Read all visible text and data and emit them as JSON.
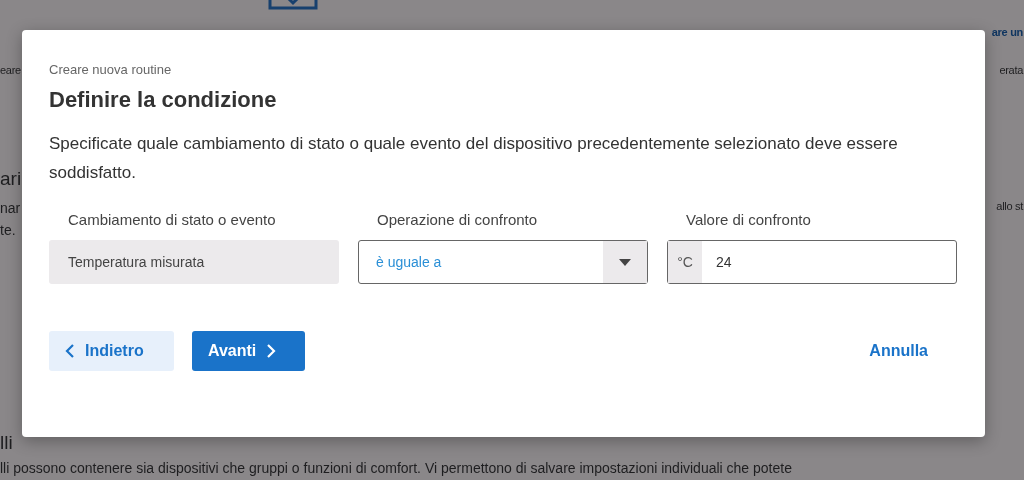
{
  "background": {
    "texts": [
      {
        "kind": "link",
        "text": "are un"
      },
      {
        "kind": "plain",
        "text": "eare"
      },
      {
        "kind": "plain",
        "text": "erata"
      },
      {
        "kind": "heading",
        "text": "ari"
      },
      {
        "kind": "plain",
        "text": "nar"
      },
      {
        "kind": "plain",
        "text": "te."
      },
      {
        "kind": "plain",
        "text": "allo st"
      },
      {
        "kind": "heading",
        "text": "lli"
      },
      {
        "kind": "plain",
        "text": "lli possono contenere sia dispositivi che gruppi o funzioni di comfort. Vi permettono di salvare impostazioni individuali che potete"
      }
    ]
  },
  "dialog": {
    "breadcrumb": "Creare nuova routine",
    "title": "Definire la condizione",
    "description": "Specificate quale cambiamento di stato o quale evento del dispositivo precedentemente selezionato deve essere soddisfatto.",
    "fields": [
      {
        "kind": "readonly",
        "label": "Cambiamento di stato o evento",
        "value": "Temperatura misurata"
      },
      {
        "kind": "select",
        "label": "Operazione di confronto",
        "value": "è uguale a"
      },
      {
        "kind": "unit",
        "label": "Valore di confronto",
        "unit": "°C",
        "value": "24"
      }
    ],
    "back": "Indietro",
    "next": "Avanti",
    "cancel": "Annulla"
  }
}
